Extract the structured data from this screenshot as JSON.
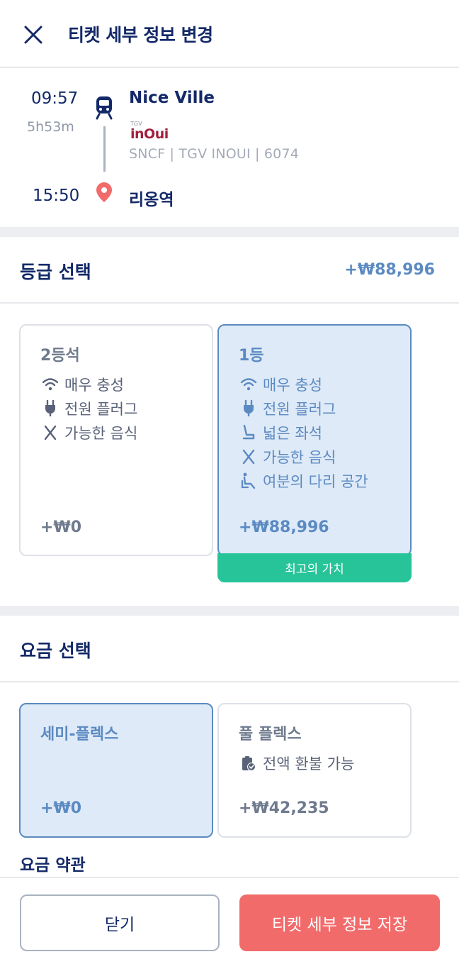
{
  "header": {
    "title": "티켓 세부 정보 변경",
    "close_icon": "close-icon"
  },
  "journey": {
    "departure_time": "09:57",
    "duration": "5h53m",
    "arrival_time": "15:50",
    "departure_station": "Nice Ville",
    "operator_logo": {
      "top": "TGV",
      "text": "inOui"
    },
    "carrier": "SNCF | TGV INOUI | 6074",
    "arrival_station": "리옹역",
    "icons": [
      "train-icon",
      "location-pin-icon"
    ]
  },
  "class_section": {
    "title": "등급 선택",
    "price": "+₩88,996",
    "options": [
      {
        "title": "2등석",
        "features": [
          {
            "icon": "wifi-icon",
            "label": "매우 충성"
          },
          {
            "icon": "plug-icon",
            "label": "전원 플러그"
          },
          {
            "icon": "food-icon",
            "label": "가능한 음식"
          }
        ],
        "price": "+₩0",
        "selected": false
      },
      {
        "title": "1등",
        "features": [
          {
            "icon": "wifi-icon",
            "label": "매우 충성"
          },
          {
            "icon": "plug-icon",
            "label": "전원 플러그"
          },
          {
            "icon": "seat-icon",
            "label": "넓은 좌석"
          },
          {
            "icon": "food-icon",
            "label": "가능한 음식"
          },
          {
            "icon": "legroom-icon",
            "label": "여분의 다리 공간"
          }
        ],
        "price": "+₩88,996",
        "selected": true,
        "badge": "최고의 가치"
      }
    ]
  },
  "fare_section": {
    "title": "요금 선택",
    "options": [
      {
        "title": "세미-플렉스",
        "features": [],
        "price": "+₩0",
        "selected": true
      },
      {
        "title": "풀 플렉스",
        "features": [
          {
            "icon": "refund-icon",
            "label": "전액 환불 가능"
          }
        ],
        "price": "+₩42,235",
        "selected": false
      }
    ],
    "terms_label": "요금 약관"
  },
  "footer": {
    "close_label": "닫기",
    "save_label": "티켓 세부 정보 저장"
  },
  "colors": {
    "navy": "#132968",
    "accent_blue": "#5b8ac2",
    "selected_bg": "#deeaf7",
    "badge_green": "#27c49a",
    "save_red": "#f26b6b"
  }
}
